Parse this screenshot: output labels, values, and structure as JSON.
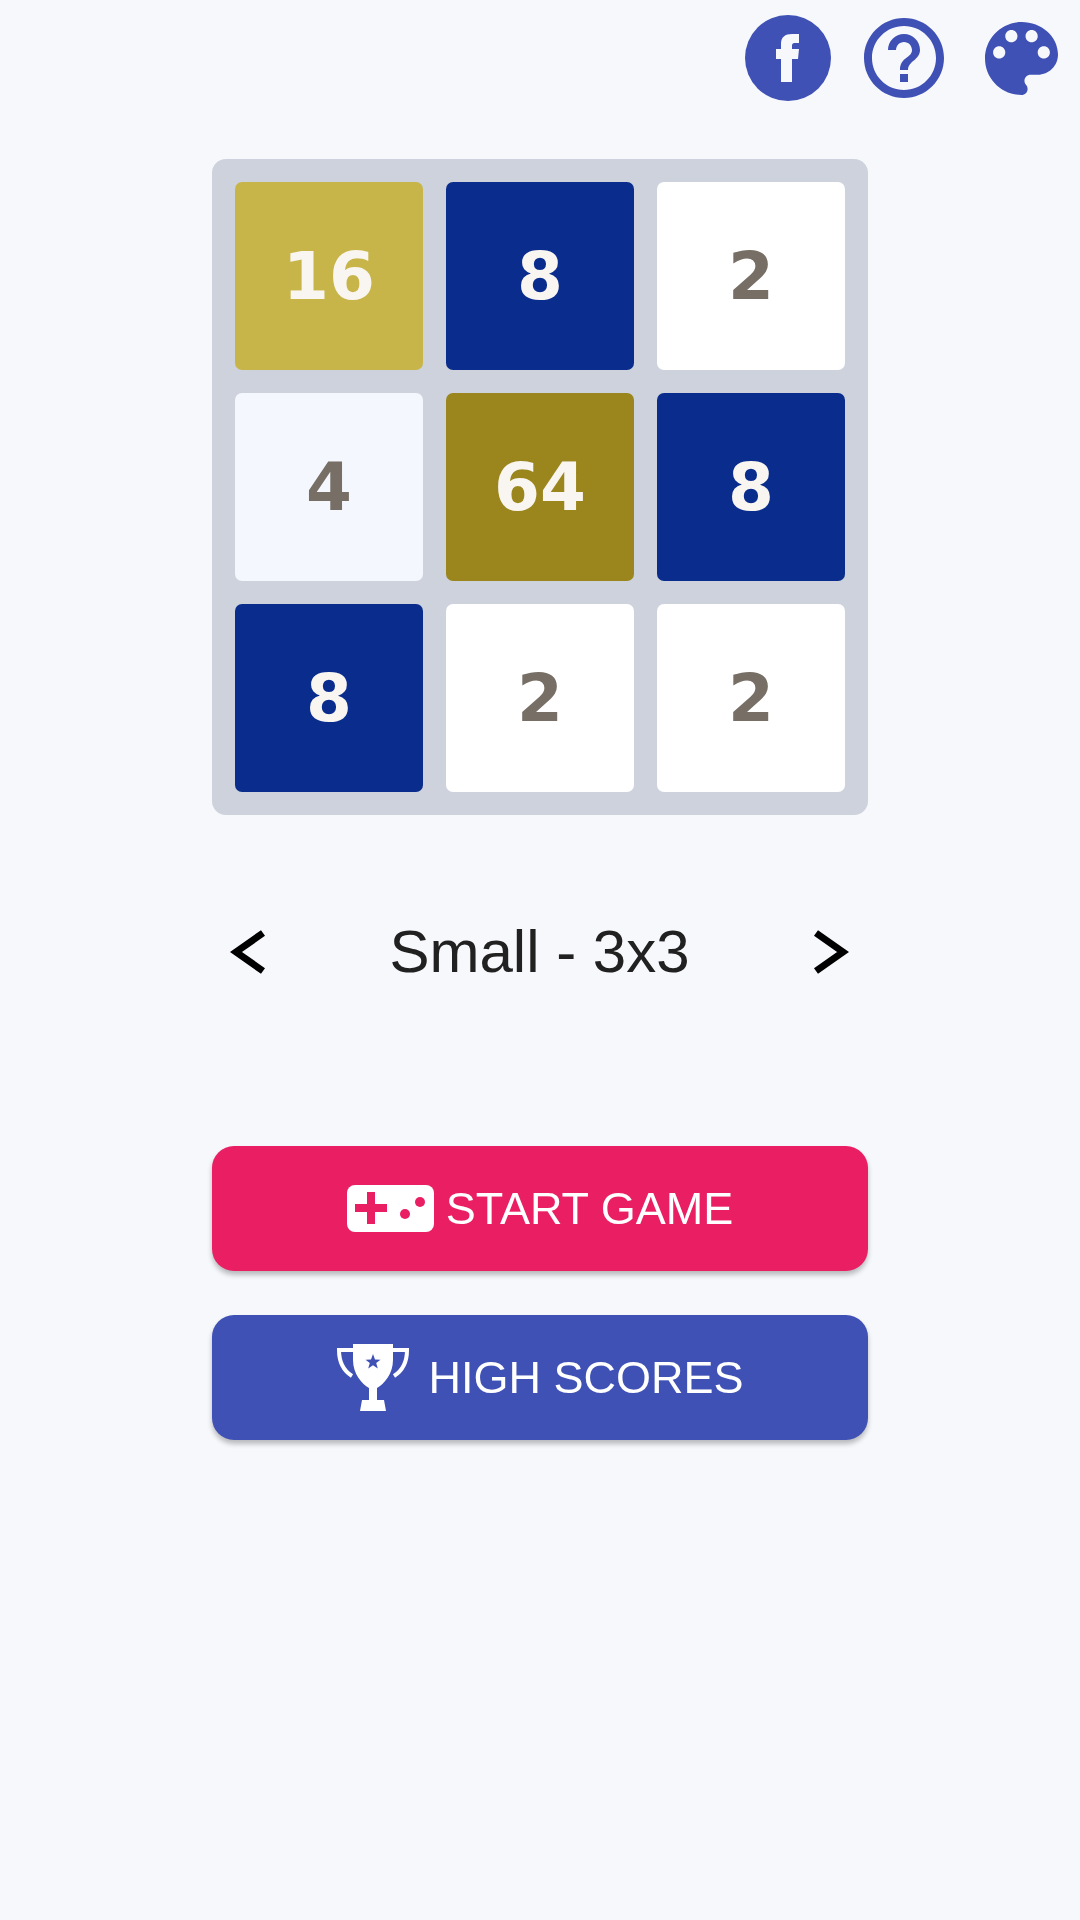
{
  "board": {
    "rows": [
      {
        "tiles": [
          {
            "value": "16",
            "color": "#c8b54a"
          },
          {
            "value": "8",
            "color": "#0a2c8c"
          },
          {
            "value": "2",
            "color": "#ffffff"
          }
        ]
      },
      {
        "tiles": [
          {
            "value": "4",
            "color": "#f4f7fe"
          },
          {
            "value": "64",
            "color": "#9a861c"
          },
          {
            "value": "8",
            "color": "#0a2c8c"
          }
        ]
      },
      {
        "tiles": [
          {
            "value": "8",
            "color": "#0a2c8c"
          },
          {
            "value": "2",
            "color": "#ffffff"
          },
          {
            "value": "2",
            "color": "#ffffff"
          }
        ]
      }
    ]
  },
  "size_selector": {
    "label": "Small - 3x3"
  },
  "buttons": [
    {
      "label": "START GAME",
      "kind": "play",
      "color": "#e91e63"
    },
    {
      "label": "HIGH SCORES",
      "kind": "scores",
      "color": "#3f51b5"
    }
  ]
}
